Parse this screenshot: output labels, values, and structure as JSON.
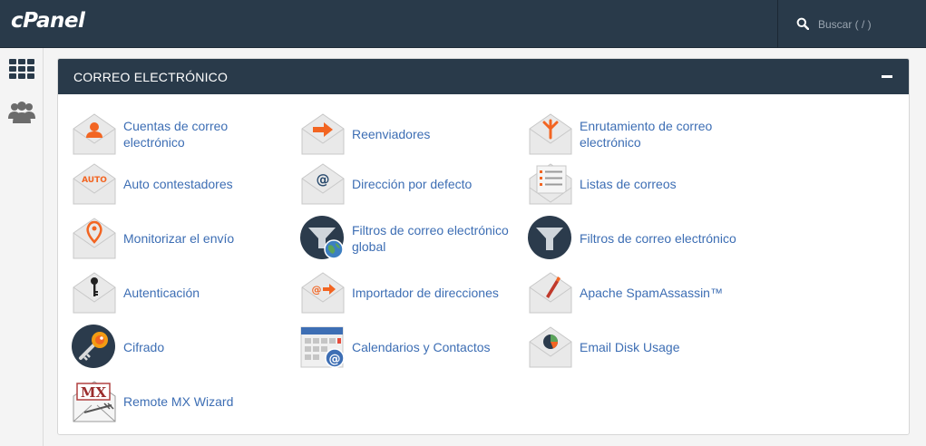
{
  "header": {
    "logo": "cPanel",
    "search_placeholder": "Buscar ( / )"
  },
  "section": {
    "title": "CORREO ELECTRÓNICO"
  },
  "items": [
    {
      "label": "Cuentas de correo electrónico",
      "icon": "email-accounts-icon"
    },
    {
      "label": "Reenviadores",
      "icon": "forwarders-icon"
    },
    {
      "label": "Enrutamiento de correo electrónico",
      "icon": "email-routing-icon"
    },
    {
      "label": "Auto contestadores",
      "icon": "autoresponders-icon",
      "badge": "AUTO"
    },
    {
      "label": "Dirección por defecto",
      "icon": "default-address-icon",
      "badge": "@"
    },
    {
      "label": "Listas de correos",
      "icon": "mailing-lists-icon"
    },
    {
      "label": "Monitorizar el envío",
      "icon": "track-delivery-icon"
    },
    {
      "label": "Filtros de correo electrónico global",
      "icon": "global-filters-icon"
    },
    {
      "label": "Filtros de correo electrónico",
      "icon": "email-filters-icon"
    },
    {
      "label": "Autenticación",
      "icon": "authentication-icon"
    },
    {
      "label": "Importador de direcciones",
      "icon": "address-importer-icon",
      "badge": "@"
    },
    {
      "label": "Apache SpamAssassin™",
      "icon": "spamassassin-icon"
    },
    {
      "label": "Cifrado",
      "icon": "encryption-icon"
    },
    {
      "label": "Calendarios y Contactos",
      "icon": "calendars-contacts-icon",
      "badge": "@"
    },
    {
      "label": "Email Disk Usage",
      "icon": "email-disk-usage-icon"
    },
    {
      "label": "Remote MX Wizard",
      "icon": "remote-mx-wizard-icon",
      "badge": "MX"
    }
  ],
  "colors": {
    "navy": "#293a4a",
    "link": "#3d6eb4",
    "accent": "#f26522"
  }
}
